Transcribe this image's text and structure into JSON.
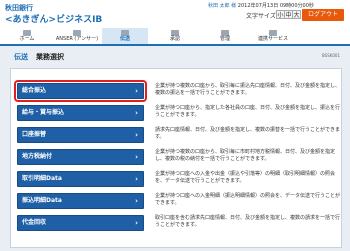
{
  "header": {
    "bank_name": "秋田銀行",
    "service_name": "<あきぎん>ビジネスIB",
    "user_name": "秋田 太郎 様",
    "last_login": "2012年07月13日 09時00分00秒",
    "text_size_label": "文字サイズ",
    "size_small": "小",
    "size_medium": "中",
    "size_large": "大",
    "logout_label": "ログアウト"
  },
  "tabs": [
    {
      "label": "ホーム",
      "icon": "house-icon"
    },
    {
      "label": "ANSER (アンサー)",
      "icon": "document-icon"
    },
    {
      "label": "伝送",
      "icon": "transfer-icon"
    },
    {
      "label": "承認",
      "icon": "approval-icon"
    },
    {
      "label": "管理",
      "icon": "admin-icon"
    },
    {
      "label": "連携サービス",
      "icon": "link-icon"
    }
  ],
  "active_tab": 2,
  "breadcrumb": {
    "section": "伝送",
    "page": "業務選択",
    "screen_id": "BSSK001"
  },
  "menu": [
    {
      "label": "総合振込",
      "desc": "企業が持つ複数の口座から、取引毎に振込先口座情報、日付、及び金額を指定し、複数の振込を一括で行うことができます。",
      "selected": true
    },
    {
      "label": "給与・賞与振込",
      "desc": "企業が持つ口座から、指定した各社員の口座、日付、及び金額を指定し、振込を行うことができます。",
      "selected": false
    },
    {
      "label": "口座振替",
      "desc": "請求先口座情報、日付、及び金額を指定し、複数の振替を一括で行うことができます。",
      "selected": false
    },
    {
      "label": "地方税納付",
      "desc": "企業が持つ複数の口座から、取引毎に市町村地方税情報、日付、及び金額を指定し、複数の税の納付を一括で行うことができます。",
      "selected": false
    },
    {
      "label": "取引明細Data",
      "desc": "企業が持つ口座への入金や出金（振込や引落等）の明細（取引明細情報）の照会を、データ伝送で行うことができます。",
      "selected": false
    },
    {
      "label": "振込明細Data",
      "desc": "企業が持つ口座への入金明細（振込明細情報）の照会を、データ伝送で行うことができます。",
      "selected": false
    },
    {
      "label": "代金回収",
      "desc": "取引口座を含む請求先口座情報、日付、及び金額を指定し、複数の請求を一括で行うことができます。",
      "selected": false
    }
  ],
  "colors": {
    "accent": "#1f6fb5",
    "button": "#1e5fa6",
    "logout": "#e8590c",
    "highlight": "#e02020"
  }
}
